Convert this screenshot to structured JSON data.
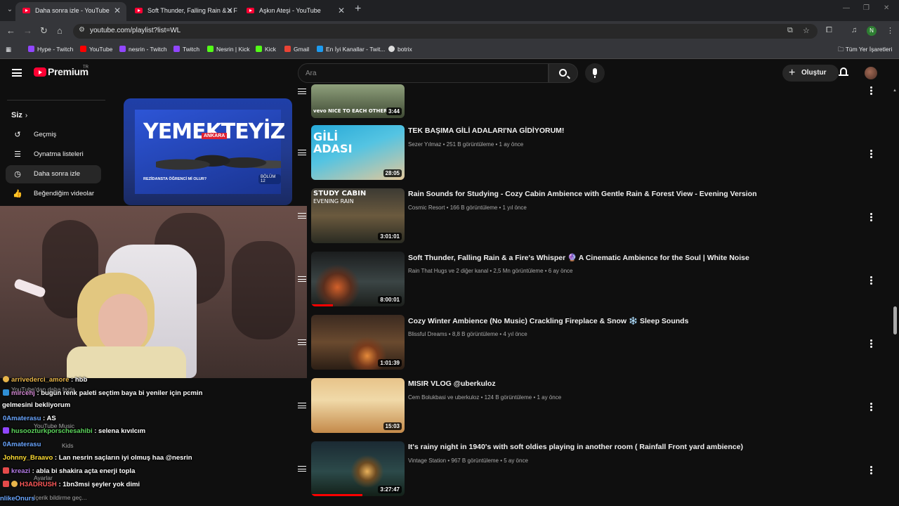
{
  "browser": {
    "tabs": [
      {
        "title": "Daha sonra izle - YouTube"
      },
      {
        "title": "Soft Thunder, Falling Rain & a F"
      },
      {
        "title": "Aşkın Ateşi - YouTube"
      }
    ],
    "url": "youtube.com/playlist?list=WL",
    "profile_initial": "N",
    "bookmarks": [
      {
        "label": "Hype - Twitch",
        "color": "#9146ff"
      },
      {
        "label": "YouTube",
        "color": "#ff0000"
      },
      {
        "label": "nesrin - Twitch",
        "color": "#9146ff"
      },
      {
        "label": "Twitch",
        "color": "#9146ff"
      },
      {
        "label": "Nesrin | Kick",
        "color": "#53fc18"
      },
      {
        "label": "Kick",
        "color": "#53fc18"
      },
      {
        "label": "Gmail",
        "color": "#ea4335"
      },
      {
        "label": "En İyi Kanallar - Twit...",
        "color": "#1d9bf0"
      },
      {
        "label": "botrix",
        "color": "#dddddd"
      }
    ],
    "all_bookmarks": "Tüm Yer İşaretleri"
  },
  "youtube": {
    "logo": "Premium",
    "logo_region": "TR",
    "search_placeholder": "Ara",
    "create_label": "Oluştur"
  },
  "sidebar": {
    "section": "Siz",
    "items": [
      {
        "label": "Geçmiş",
        "icon": "history-icon"
      },
      {
        "label": "Oynatma listeleri",
        "icon": "playlists-icon"
      },
      {
        "label": "Daha sonra izle",
        "icon": "clock-icon"
      },
      {
        "label": "Beğendiğim videolar",
        "icon": "thumbs-up-icon"
      }
    ]
  },
  "playlist_thumbnail": {
    "title": "YEMEKTEYİZ",
    "city": "ANKARA",
    "caption": "REZİDANSTA ÖĞRENCİ Mİ OLUR?",
    "episode": "BÖLÜM 12"
  },
  "videos": [
    {
      "title": "",
      "meta": "",
      "duration": "3:44",
      "thumb_text": "vevo NICE TO EACH OTHER",
      "progress": 0
    },
    {
      "title": "TEK BAŞIMA GİLİ ADALARI'NA GİDİYORUM!",
      "meta": "Sezer Yılmaz • 251 B görüntüleme • 1 ay önce",
      "duration": "28:05",
      "thumb_text": "GİLİ ADASI",
      "progress": 0
    },
    {
      "title": "Rain Sounds for Studying - Cozy Cabin Ambience with Gentle Rain & Forest View - Evening Version",
      "meta": "Cosmic Resort • 166 B görüntüleme • 1 yıl önce",
      "duration": "3:01:01",
      "thumb_text": "STUDY CABIN",
      "thumb_sub": "EVENING RAIN",
      "progress": 0
    },
    {
      "title": "Soft Thunder, Falling Rain & a Fire's Whisper 🔮 A Cinematic Ambience for the Soul | White Noise",
      "meta": "Rain That Hugs ve 2 diğer kanal • 2,5 Mn görüntüleme • 6 ay önce",
      "duration": "8:00:01",
      "thumb_text": "",
      "progress": 0.23
    },
    {
      "title": "Cozy Winter Ambience (No Music) Crackling Fireplace & Snow ❄️ Sleep Sounds",
      "meta": "Blissful Dreams • 8,8 B görüntüleme • 4 yıl önce",
      "duration": "1:01:39",
      "thumb_text": "",
      "progress": 0
    },
    {
      "title": "MISIR VLOG @uberkuloz",
      "meta": "Cem Bolukbasi ve uberkuloz • 124 B görüntüleme • 1 ay önce",
      "duration": "15:03",
      "thumb_text": "",
      "progress": 0
    },
    {
      "title": "It's rainy night in 1940's with soft oldies playing in another room ( Rainfall Front yard ambience)",
      "meta": "Vintage Station • 967 B görüntüleme • 5 ay önce",
      "duration": "3:27:47",
      "thumb_text": "",
      "progress": 0.55
    }
  ],
  "chat": [
    {
      "user": "arrivederci_amore",
      "color": "#e8b54a",
      "msg": ": hbb"
    },
    {
      "user": "mircehj",
      "color": "#d88bd8",
      "msg": ": bugün renk paleti seçtim baya bi yeniler için pcmin"
    },
    {
      "user": "",
      "color": "#ffffff",
      "msg": "gelmesini bekliyorum"
    },
    {
      "user": "0Amaterasu",
      "color": "#6aa6ff",
      "msg": ": AS"
    },
    {
      "user": "husoozturkporschesahibi",
      "color": "#5cd65c",
      "msg": ": selena kıvılcım"
    },
    {
      "user": "0Amaterasu",
      "color": "#6aa6ff",
      "msg": ""
    },
    {
      "user": "Johnny_Braavo",
      "color": "#ffdd33",
      "msg": ": Lan nesrin saçların iyi olmuş haa @nesrin"
    },
    {
      "user": "kreazi",
      "color": "#b47ce8",
      "msg": ": abla bi shakira açta enerji topla"
    },
    {
      "user": "H3ADRUSH",
      "color": "#ff5a5a",
      "msg": ": 1bn3msi şeyler yok dimi"
    },
    {
      "user": "nlikeOnurs",
      "color": "#6aa6ff",
      "msg": ""
    }
  ],
  "chat_ghost": {
    "yt_more": "YouTube'dan daha fazla",
    "yt_music": "YouTube Music",
    "yt_kids": "Kids",
    "settings": "Ayarlar",
    "feedback": "İçerik bildirme geç..."
  }
}
